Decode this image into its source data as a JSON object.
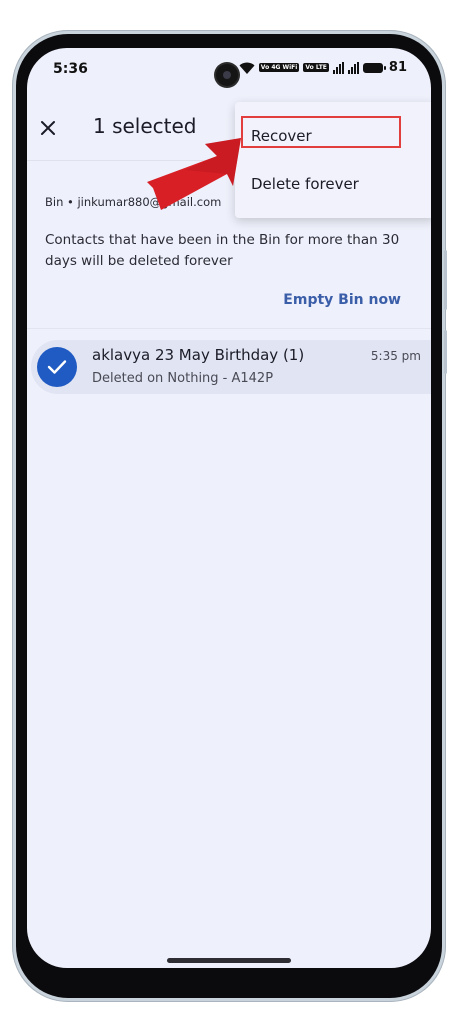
{
  "status_bar": {
    "time": "5:36",
    "network_badge_1": "Vo 4G WiFi",
    "network_badge_2": "Vo LTE",
    "battery": "81",
    "icons": [
      "wifi-icon",
      "volte-icon",
      "signal-icon",
      "battery-icon"
    ]
  },
  "app_bar": {
    "close_icon": "close-icon",
    "title": "1 selected"
  },
  "menu": {
    "items": [
      "Recover",
      "Delete forever"
    ]
  },
  "bin": {
    "account": "Bin • jinkumar880@gmail.com",
    "info": "Contacts that have been in the Bin for more than 30 days will be deleted forever",
    "empty_action": "Empty Bin now"
  },
  "contacts": [
    {
      "name": "aklavya 23 May Birthday (1)",
      "subtitle": "Deleted on Nothing - A142P",
      "time": "5:35 pm",
      "selected": true
    }
  ],
  "colors": {
    "accent": "#1f5bc2",
    "link": "#3b5ea9",
    "highlight": "#e23e3e",
    "arrow": "#d81f26"
  }
}
